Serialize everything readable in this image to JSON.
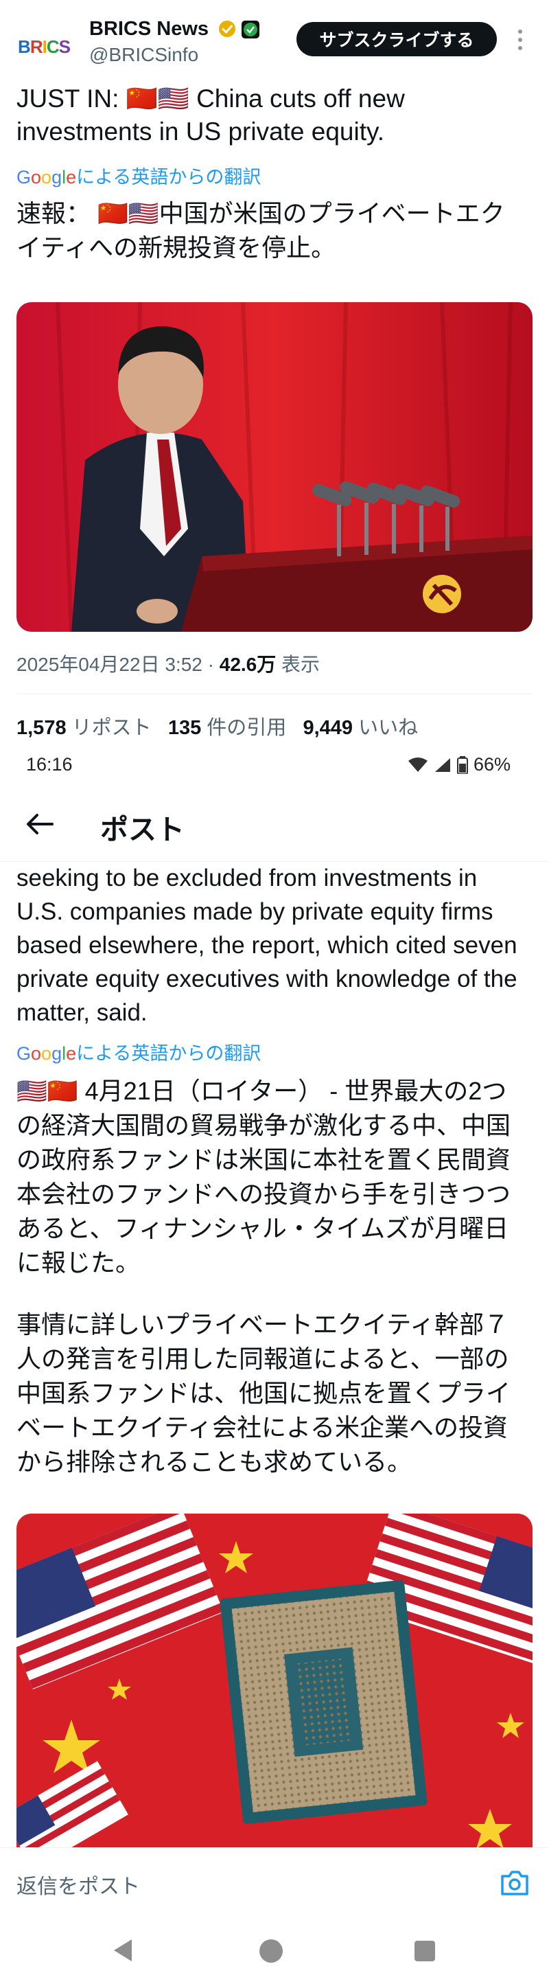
{
  "author": {
    "avatar_text": "BRICS",
    "name": "BRICS News",
    "handle": "@BRICSinfo",
    "verified_badge": "gold-verified-check",
    "affiliate_badge": "affiliate-badge"
  },
  "header": {
    "subscribe_label": "サブスクライブする",
    "more_icon": "vertical-ellipsis-icon"
  },
  "tweet": {
    "original_text": "JUST IN: 🇨🇳🇺🇸 China cuts off new investments in US private equity.",
    "translation_label_brand": "Google",
    "translation_label_suffix": "による英語からの翻訳",
    "translated_text": "速報： 🇨🇳🇺🇸中国が米国のプライベートエクイティへの新規投資を停止。",
    "image_description_alt": "speaker at lectern with microphones, red background"
  },
  "meta": {
    "timestamp": "2025年04月22日 3:52",
    "separator": " · ",
    "views_count": "42.6万",
    "views_label": " 表示"
  },
  "stats": {
    "reposts_count": "1,578",
    "reposts_label": "リポスト",
    "quotes_count": "135",
    "quotes_label": "件の引用",
    "likes_count": "9,449",
    "likes_label": "いいね"
  },
  "status_bar": {
    "time": "16:16",
    "battery": "66%"
  },
  "nav": {
    "title": "ポスト",
    "back_icon": "back-arrow-icon"
  },
  "reply_tweet": {
    "original_text": "seeking to be excluded from investments in U.S. companies made by private equity firms based elsewhere, the report, which cited seven private equity executives with knowledge of the matter, said.",
    "translation_label_brand": "Google",
    "translation_label_suffix": "による英語からの翻訳",
    "translated_p1": "🇺🇸🇨🇳 4月21日（ロイター） - 世界最大の2つの経済大国間の貿易戦争が激化する中、中国の政府系ファンドは米国に本社を置く民間資本会社のファンドへの投資から手を引きつつあると、フィナンシャル・タイムズが月曜日に報じた。",
    "translated_p2": "事情に詳しいプライベートエクイティ幹部７人の発言を引用した同報道によると、一部の中国系ファンドは、他国に拠点を置くプライベートエクイティ会社による米企業への投資から排除されることも求めている。"
  },
  "reply_bar": {
    "placeholder": "返信をポスト",
    "camera_icon": "camera-icon"
  },
  "colors": {
    "text": "#0f1419",
    "muted": "#536471",
    "link": "#1d9bf0",
    "button_bg": "#0f1419",
    "gold": "#e8b000"
  }
}
